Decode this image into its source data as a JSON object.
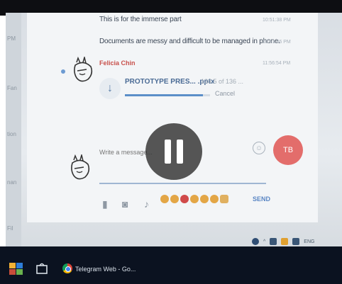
{
  "messages": [
    {
      "text": "This is for the immerse part",
      "time": "10:51:38 PM"
    },
    {
      "text": "Documents are messy and difficult to be managed in phone.",
      "time": "10:51:46 PM"
    }
  ],
  "sender": {
    "name": "Felicia Chin",
    "time": "11:56:54 PM"
  },
  "file": {
    "name": "PROTOTYPE PRES... .pptx",
    "size": "134.5 of 136 ...",
    "cancel_label": "Cancel",
    "progress": 0.92
  },
  "composer": {
    "placeholder": "Write a message...",
    "send_label": "SEND",
    "avatar_initials": "TB"
  },
  "left_column": [
    "PM",
    "Fan",
    "tion",
    "nan",
    "Fil"
  ],
  "taskbar": {
    "chrome_label": "Telegram Web - Go..."
  },
  "tray": {
    "lang": "ENG"
  },
  "colors": {
    "accent": "#5b8fc8",
    "sender_name": "#c8504b",
    "avatar_red": "#e36d6b"
  }
}
